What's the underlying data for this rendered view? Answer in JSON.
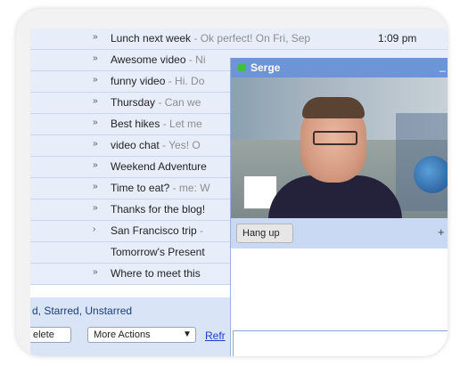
{
  "mail": {
    "rows": [
      {
        "marker": "»",
        "subject": "Lunch next week",
        "snippet": " - Ok perfect! On Fri, Sep",
        "time": "1:09 pm"
      },
      {
        "marker": "»",
        "subject": "Awesome video",
        "snippet": " - Ni",
        "time": ""
      },
      {
        "marker": "»",
        "subject": "funny video",
        "snippet": " - Hi. Do",
        "time": ""
      },
      {
        "marker": "»",
        "subject": "Thursday",
        "snippet": " - Can we",
        "time": ""
      },
      {
        "marker": "»",
        "subject": "Best hikes",
        "snippet": " - Let me",
        "time": ""
      },
      {
        "marker": "»",
        "subject": "video chat",
        "snippet": " - Yes! O",
        "time": ""
      },
      {
        "marker": "»",
        "subject": "Weekend Adventure",
        "snippet": "",
        "time": ""
      },
      {
        "marker": "»",
        "subject": "Time to eat?",
        "snippet": " - me: W",
        "time": ""
      },
      {
        "marker": "»",
        "subject": "Thanks for the blog!",
        "snippet": "",
        "time": ""
      },
      {
        "marker": "›",
        "subject": "San Francisco trip",
        "snippet": " -",
        "time": ""
      },
      {
        "marker": "",
        "subject": "Tomorrow's Present",
        "snippet": "",
        "time": ""
      },
      {
        "marker": "»",
        "subject": "Where to meet this",
        "snippet": "",
        "time": ""
      }
    ],
    "select_text": "d, Starred, Unstarred",
    "delete_label": "elete",
    "more_actions_label": "More Actions",
    "more_actions_arrow": "▼",
    "refresh_label": "Refr"
  },
  "chat": {
    "contact_name": "Serge",
    "minimize_glyph": "_",
    "hangup_label": "Hang up",
    "plus_glyph": "+",
    "status_color": "#3fbf3a"
  }
}
